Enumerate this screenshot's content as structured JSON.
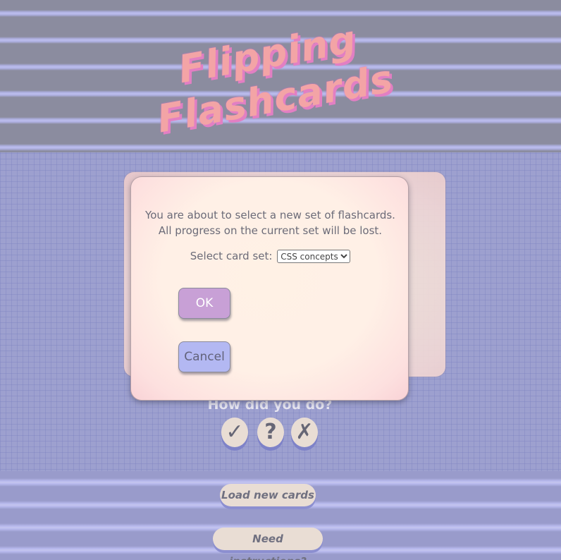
{
  "app": {
    "title_line1": "Flipping",
    "title_line2": "Flashcards"
  },
  "rating": {
    "prompt": "How did you do?",
    "buttons": [
      {
        "label": "✓",
        "icon": "checkmark-icon"
      },
      {
        "label": "?",
        "icon": "question-icon"
      },
      {
        "label": "✗",
        "icon": "cross-icon"
      }
    ]
  },
  "actions": {
    "load_label": "Load new cards",
    "help_label": "Need instructions?"
  },
  "dialog": {
    "message_line1": "You are about to select a new set of flashcards.",
    "message_line2": "All progress on the current set will be lost.",
    "select_label": "Select card set:",
    "selected_set": "CSS concepts",
    "ok_label": "OK",
    "cancel_label": "Cancel"
  },
  "colors": {
    "title": "#f3a4a6",
    "title_shadow": "#e27fc3",
    "ok_button": "#c8a0d6",
    "cancel_button": "#b3b8f2",
    "dialog_bg": "#fff1e5"
  }
}
